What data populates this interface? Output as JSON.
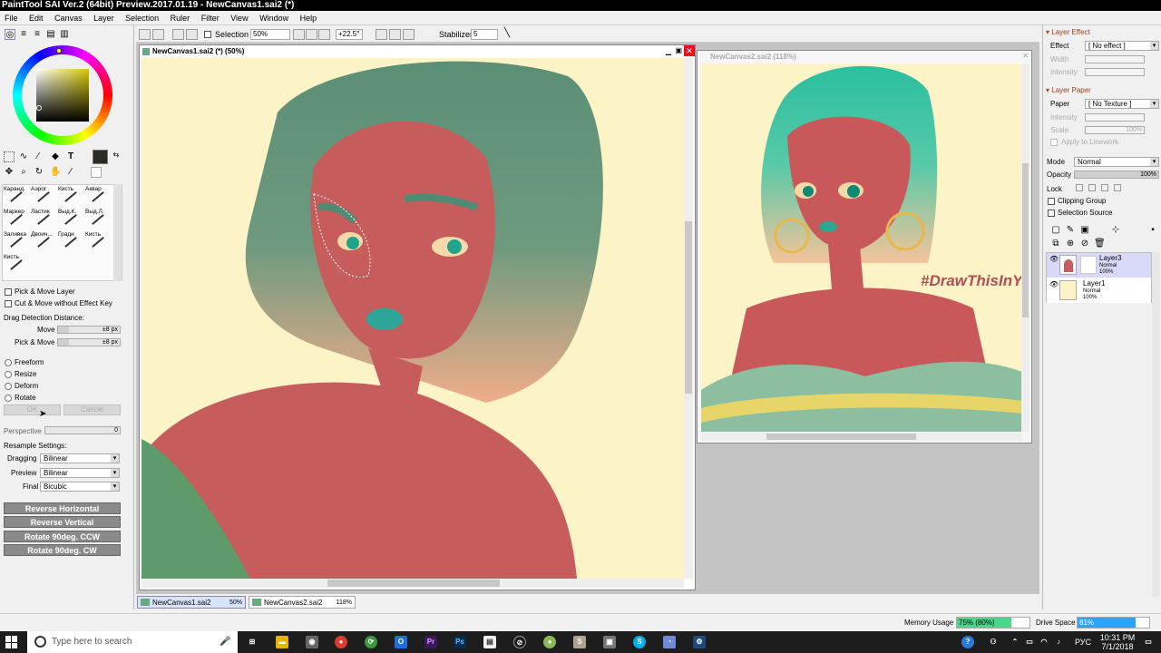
{
  "window": {
    "title": "PaintTool SAI Ver.2 (64bit) Preview.2017.01.19 - NewCanvas1.sai2 (*)"
  },
  "menu": [
    "File",
    "Edit",
    "Canvas",
    "Layer",
    "Selection",
    "Ruler",
    "Filter",
    "View",
    "Window",
    "Help"
  ],
  "toolbar": {
    "selection_label": "Selection",
    "zoom": "50%",
    "rotation": "+22.5°",
    "stabilizer_label": "Stabilizer",
    "stabilizer_value": "5"
  },
  "brushes": [
    {
      "label": "Каранд."
    },
    {
      "label": "Аэрог"
    },
    {
      "label": "Кисть"
    },
    {
      "label": "Аквар"
    },
    {
      "label": "Маркер"
    },
    {
      "label": "Ластик"
    },
    {
      "label": "Выд.К."
    },
    {
      "label": "Выд.Л."
    },
    {
      "label": "Заливка"
    },
    {
      "label": "Двоич..."
    },
    {
      "label": "Гради"
    },
    {
      "label": "Кисть"
    },
    {
      "label": "Кисть"
    }
  ],
  "left_panel": {
    "pick_move_layer": "Pick & Move Layer",
    "cut_move": "Cut & Move without Effect Key",
    "drag_detection": "Drag Detection Distance:",
    "move_label": "Move",
    "move_value": "±8 px",
    "pick_move_label": "Pick & Move",
    "pick_move_value": "±8 px",
    "modes": [
      "Freeform",
      "Resize",
      "Deform",
      "Rotate"
    ],
    "ok": "OK",
    "cancel": "Cancel",
    "perspective_label": "Perspective",
    "perspective_value": "0",
    "resample_label": "Resample Settings:",
    "dragging_label": "Dragging",
    "dragging_value": "Bilinear",
    "preview_label": "Preview",
    "preview_value": "Bilinear",
    "final_label": "Final",
    "final_value": "Bicubic",
    "buttons": [
      "Reverse Horizontal",
      "Reverse Vertical",
      "Rotate 90deg. CCW",
      "Rotate 90deg. CW"
    ]
  },
  "canvas1": {
    "title": "NewCanvas1.sai2 (*) (50%)"
  },
  "canvas2": {
    "title": "NewCanvas2.sai2 (118%)",
    "watermark": "#DrawThisInYou"
  },
  "right_panel": {
    "layer_effect_header": "Layer Effect",
    "effect_label": "Effect",
    "effect_value": "[ No effect ]",
    "width_label": "Width",
    "intensity_label": "Intensity",
    "layer_paper_header": "Layer Paper",
    "paper_label": "Paper",
    "paper_value": "[ No Texture ]",
    "intensity2_label": "Intensity",
    "scale_label": "Scale",
    "scale_value": "100%",
    "apply_linework": "Apply to Linework",
    "mode_label": "Mode",
    "mode_value": "Normal",
    "opacity_label": "Opacity",
    "opacity_value": "100%",
    "lock_label": "Lock",
    "clipping_group": "Clipping Group",
    "selection_source": "Selection Source",
    "layers": [
      {
        "name": "Layer3",
        "mode": "Normal",
        "opacity": "100%"
      },
      {
        "name": "Layer1",
        "mode": "Normal",
        "opacity": "100%"
      }
    ]
  },
  "tabs": [
    {
      "name": "NewCanvas1.sai2",
      "zoom": "50%"
    },
    {
      "name": "NewCanvas2.sai2",
      "zoom": "118%"
    }
  ],
  "status": {
    "memory_label": "Memory Usage",
    "memory_value": "75% (80%)",
    "memory_fraction": 0.75,
    "drive_label": "Drive Space",
    "drive_value": "81%",
    "drive_fraction": 0.81
  },
  "taskbar": {
    "search_placeholder": "Type here to search",
    "lang": "РУС",
    "time": "10:31 PM",
    "date": "7/1/2018"
  }
}
